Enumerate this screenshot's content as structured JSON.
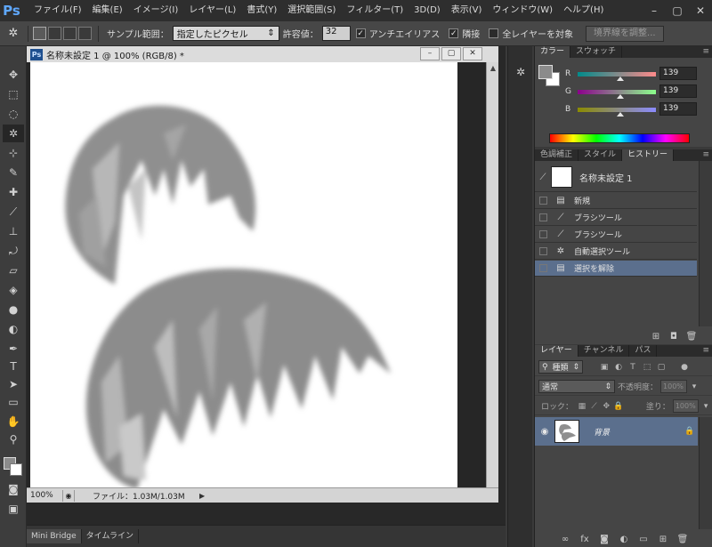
{
  "app": {
    "logo": "Ps",
    "menu": [
      "ファイル(F)",
      "編集(E)",
      "イメージ(I)",
      "レイヤー(L)",
      "書式(Y)",
      "選択範囲(S)",
      "フィルター(T)",
      "3D(D)",
      "表示(V)",
      "ウィンドウ(W)",
      "ヘルプ(H)"
    ],
    "window_controls": [
      "–",
      "▢",
      "✕"
    ]
  },
  "options_bar": {
    "sample_label": "サンプル範囲：",
    "sample_value": "指定したピクセル",
    "tolerance_label": "許容値：",
    "tolerance_value": "32",
    "antialias_label": "アンチエイリアス",
    "contiguous_label": "隣接",
    "all_layers_label": "全レイヤーを対象",
    "refine_edge_label": "境界線を調整..."
  },
  "document": {
    "tab_icon": "Ps",
    "title": "名称未設定 1 @ 100% (RGB/8) *",
    "zoom": "100%",
    "file_info": "ファイル：1.03M/1.03M"
  },
  "bottom_tabs": [
    "Mini Bridge",
    "タイムライン"
  ],
  "color_panel": {
    "tabs": [
      "カラー",
      "スウォッチ"
    ],
    "fg_color": "#8b8b8b",
    "channels": [
      {
        "letter": "R",
        "value": "139",
        "track": "linear-gradient(to right,#008b8b,#ff8b8b)"
      },
      {
        "letter": "G",
        "value": "139",
        "track": "linear-gradient(to right,#8b008b,#8bff8b)"
      },
      {
        "letter": "B",
        "value": "139",
        "track": "linear-gradient(to right,#8b8b00,#8b8bff)"
      }
    ],
    "channel_level": 0.545
  },
  "history_panel": {
    "tabs": [
      "色調補正",
      "スタイル",
      "ヒストリー"
    ],
    "snapshot_name": "名称未設定 1",
    "items": [
      {
        "icon": "document-icon",
        "label": "新規"
      },
      {
        "icon": "brush-icon",
        "label": "ブラシツール"
      },
      {
        "icon": "brush-icon",
        "label": "ブラシツール"
      },
      {
        "icon": "magic-wand-icon",
        "label": "自動選択ツール"
      },
      {
        "icon": "document-icon",
        "label": "選択を解除"
      }
    ],
    "selected_index": 4
  },
  "layers_panel": {
    "tabs": [
      "レイヤー",
      "チャンネル",
      "パス"
    ],
    "filter_kind": "種類",
    "blend_mode": "通常",
    "opacity_label": "不透明度：",
    "opacity_value": "100%",
    "lock_label": "ロック：",
    "fill_label": "塗り：",
    "fill_value": "100%",
    "layer_name": "背景"
  }
}
